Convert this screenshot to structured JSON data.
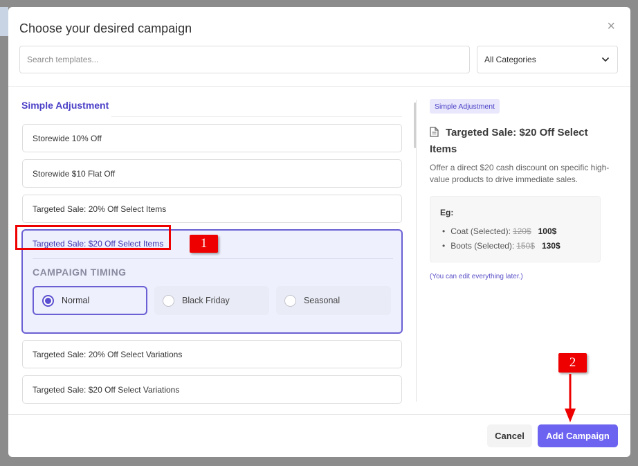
{
  "modal": {
    "title": "Choose your desired campaign",
    "close_label": "×"
  },
  "search": {
    "placeholder": "Search templates..."
  },
  "category_select": {
    "value": "All Categories"
  },
  "section": {
    "title": "Simple Adjustment"
  },
  "templates": [
    "Storewide 10% Off",
    "Storewide $10 Flat Off",
    "Targeted Sale: 20% Off Select Items",
    "Targeted Sale: $20 Off Select Items",
    "Targeted Sale: 20% Off Select Variations",
    "Targeted Sale: $20 Off Select Variations"
  ],
  "selected": {
    "title": "Targeted Sale: $20 Off Select Items",
    "timing_label": "CAMPAIGN TIMING",
    "options": [
      "Normal",
      "Black Friday",
      "Seasonal"
    ],
    "selected_option": "Normal"
  },
  "detail": {
    "tag": "Simple Adjustment",
    "title": "Targeted Sale: $20 Off Select Items",
    "description": "Offer a direct $20 cash discount on specific high-value products to drive immediate sales.",
    "eg_label": "Eg:",
    "examples": [
      {
        "name": "Coat (Selected):",
        "old": "120$",
        "new": "100$"
      },
      {
        "name": "Boots (Selected):",
        "old": "150$",
        "new": "130$"
      }
    ],
    "note": "(You can edit everything later.)"
  },
  "footer": {
    "cancel_label": "Cancel",
    "add_label": "Add Campaign"
  },
  "annotations": {
    "badge_1": "1",
    "badge_2": "2"
  },
  "colors": {
    "accent": "#6c63f0",
    "highlight": "#e00000",
    "section_title": "#4a3fc7"
  }
}
